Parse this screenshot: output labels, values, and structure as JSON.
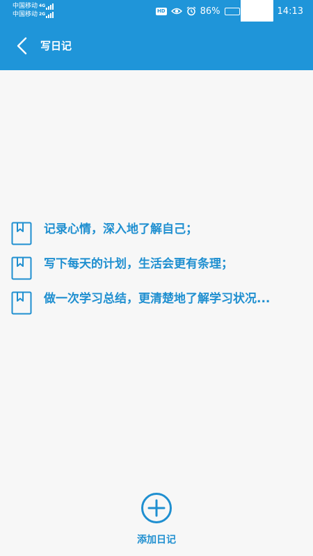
{
  "status_bar": {
    "carriers": [
      {
        "name": "中国移动",
        "network": "4G"
      },
      {
        "name": "中国移动",
        "network": "2G"
      }
    ],
    "hd_label": "HD",
    "battery_percent": "86%",
    "battery_level": 0.86,
    "time": "14:13"
  },
  "app_bar": {
    "title": "写日记"
  },
  "tips": [
    {
      "text": "记录心情，深入地了解自己；"
    },
    {
      "text": "写下每天的计划，生活会更有条理；"
    },
    {
      "text": "做一次学习总结，更清楚地了解学习状况..."
    }
  ],
  "add_diary": {
    "label": "添加日记"
  },
  "colors": {
    "primary": "#1f95d9",
    "text_accent": "#1f8fd0",
    "background": "#f7f7f7"
  }
}
